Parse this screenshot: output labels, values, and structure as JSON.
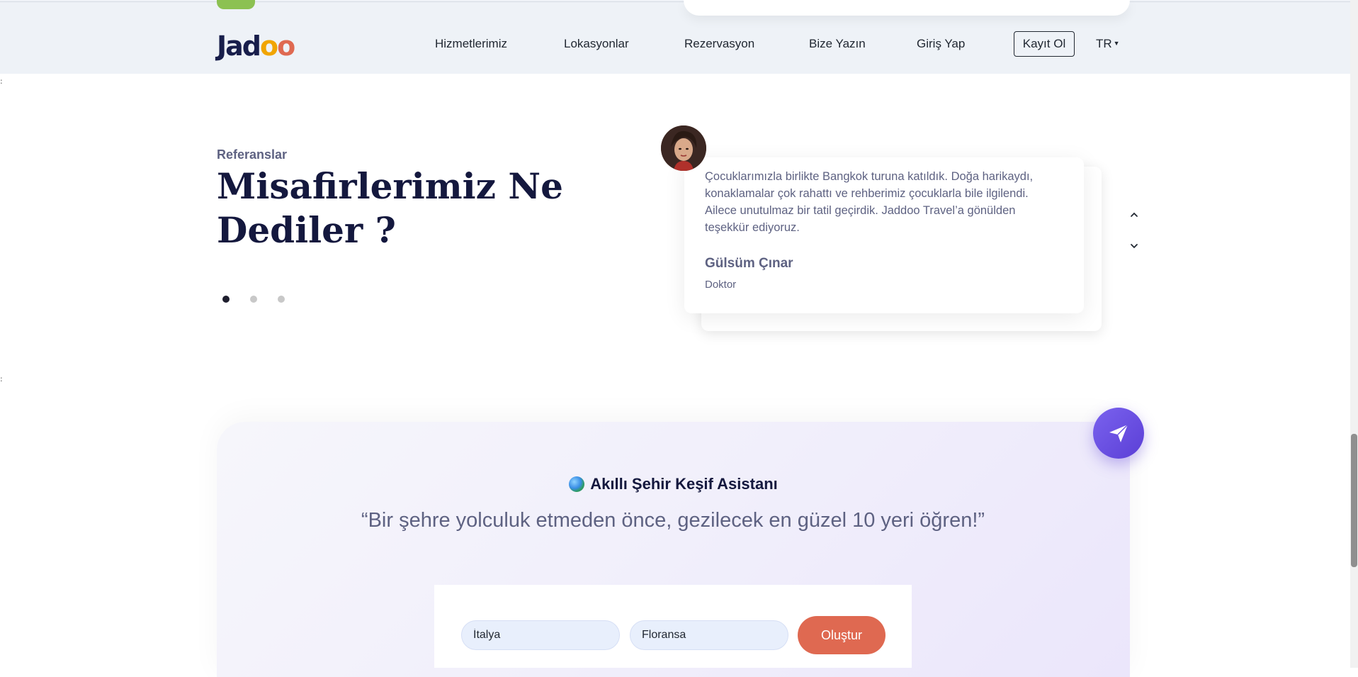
{
  "header": {
    "brand": {
      "prefix": "Jad",
      "o1": "o",
      "o2": "o"
    },
    "nav": [
      {
        "label": "Hizmetlerimiz"
      },
      {
        "label": "Lokasyonlar"
      },
      {
        "label": "Rezervasyon"
      },
      {
        "label": "Bize Yazın"
      },
      {
        "label": "Giriş Yap"
      }
    ],
    "signup_label": "Kayıt Ol",
    "language": "TR"
  },
  "testimonials": {
    "subtitle": "Referanslar",
    "title": "Misafirlerimiz Ne Dediler ?",
    "active_index": 0,
    "dot_count": 3,
    "quote": "Çocuklarımızla birlikte Bangkok turuna katıldık. Doğa harikaydı, konaklamalar çok rahattı ve rehberimiz çocuklarla bile ilgilendi. Ailece unutulmaz bir tatil geçirdik. Jaddoo Travel’a gönülden teşekkür ediyoruz.",
    "author": "Gülsüm Çınar",
    "role": "Doktor"
  },
  "assistant": {
    "title": "Akıllı Şehir Keşif Asistanı",
    "quote": "“Bir şehre yolculuk etmeden önce, gezilecek en güzel 10 yeri öğren!”",
    "country_value": "İtalya",
    "city_value": "Floransa",
    "submit_label": "Oluştur"
  },
  "colors": {
    "accent": "#df6951",
    "brand_yellow": "#f1a501",
    "fab": "#6a4fe0",
    "header_bg": "#eef2f7",
    "title": "#14183e"
  },
  "icons": {
    "prev": "chevron-up-icon",
    "next": "chevron-down-icon",
    "send": "paper-plane-icon",
    "globe": "globe-icon"
  }
}
